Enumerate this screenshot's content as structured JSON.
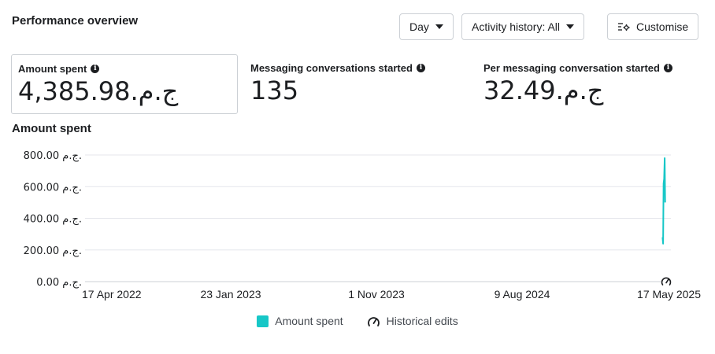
{
  "header": {
    "title": "Performance overview",
    "day_label": "Day",
    "activity_label": "Activity history: All",
    "customise_label": "Customise"
  },
  "metrics": [
    {
      "label": "Amount spent",
      "value": "4,385.98.ج.م"
    },
    {
      "label": "Messaging conversations started",
      "value": "135"
    },
    {
      "label": "Per messaging conversation started",
      "value": "32.49.ج.م"
    }
  ],
  "chart_title": "Amount spent",
  "chart_data": {
    "type": "line",
    "ylim": [
      0,
      800
    ],
    "y_ticks": [
      {
        "value": 0,
        "label": "0.00 ج.م."
      },
      {
        "value": 200,
        "label": "200.00 ج.م."
      },
      {
        "value": 400,
        "label": "400.00 ج.م."
      },
      {
        "value": 600,
        "label": "600.00 ج.م."
      },
      {
        "value": 800,
        "label": "800.00 ج.م."
      }
    ],
    "x_ticks": [
      "17 Apr 2022",
      "23 Jan 2023",
      "1 Nov 2023",
      "9 Aug 2024",
      "17 May 2025"
    ],
    "x_range": [
      "2022-04-17",
      "2025-05-17"
    ],
    "series": [
      {
        "name": "Amount spent",
        "color": "#17c7c7",
        "points": [
          {
            "date": "2025-05-07",
            "y": 280
          },
          {
            "date": "2025-05-08",
            "y": 240
          },
          {
            "date": "2025-05-09",
            "y": 620
          },
          {
            "date": "2025-05-10",
            "y": 650
          },
          {
            "date": "2025-05-11",
            "y": 780
          },
          {
            "date": "2025-05-12",
            "y": 500
          }
        ]
      }
    ],
    "annotations": [
      {
        "date": "2025-05-17",
        "icon": "historical-edit-icon"
      }
    ],
    "grid": true,
    "legend_position": "bottom-center",
    "legend": [
      {
        "label": "Amount spent",
        "color": "#17c7c7"
      },
      {
        "label": "Historical edits",
        "icon": "historical-edit-icon"
      }
    ]
  }
}
